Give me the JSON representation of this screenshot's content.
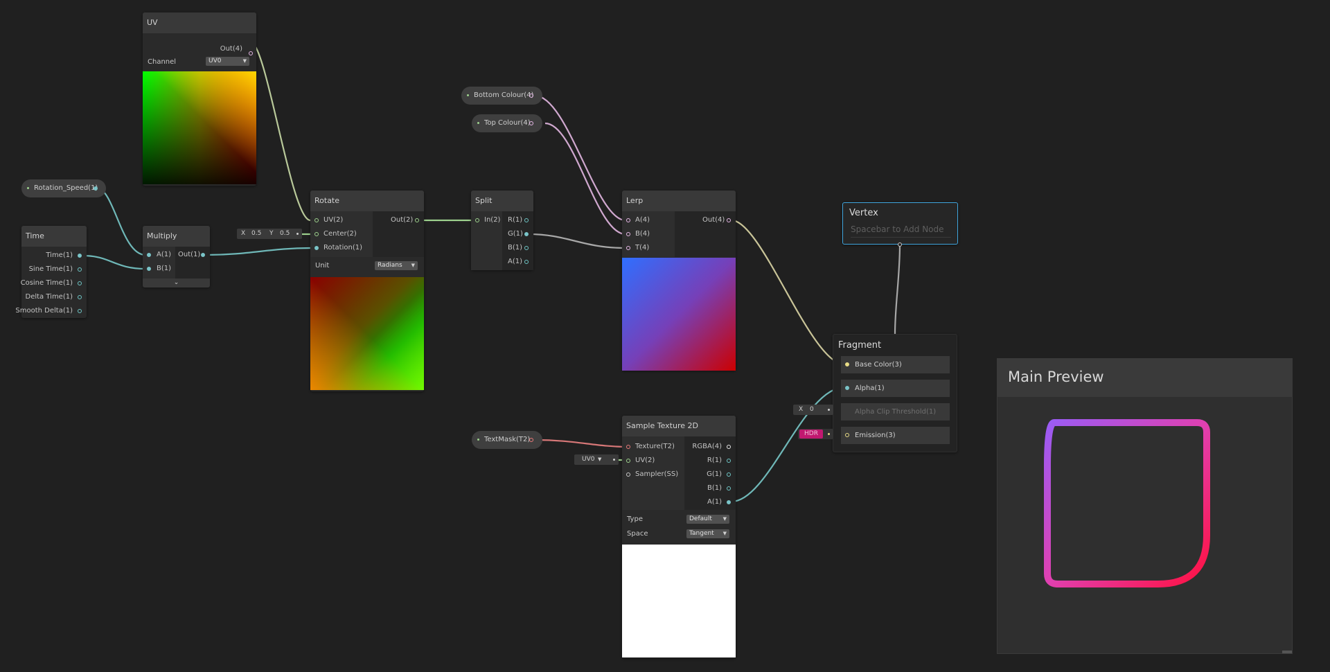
{
  "nodes": {
    "uv": {
      "title": "UV",
      "out": "Out(4)",
      "channel_label": "Channel",
      "channel_value": "UV0"
    },
    "time": {
      "title": "Time",
      "outputs": [
        "Time(1)",
        "Sine Time(1)",
        "Cosine Time(1)",
        "Delta Time(1)",
        "Smooth Delta(1)"
      ]
    },
    "multiply": {
      "title": "Multiply",
      "in_a": "A(1)",
      "in_b": "B(1)",
      "out": "Out(1)",
      "expand_icon": "chevron-down-icon"
    },
    "rotate": {
      "title": "Rotate",
      "in_uv": "UV(2)",
      "in_center": "Center(2)",
      "in_rotation": "Rotation(1)",
      "out": "Out(2)",
      "unit_label": "Unit",
      "unit_value": "Radians",
      "center_x_label": "X",
      "center_x": "0.5",
      "center_y_label": "Y",
      "center_y": "0.5"
    },
    "split": {
      "title": "Split",
      "in": "In(2)",
      "outputs": [
        "R(1)",
        "G(1)",
        "B(1)",
        "A(1)"
      ]
    },
    "lerp": {
      "title": "Lerp",
      "in_a": "A(4)",
      "in_b": "B(4)",
      "in_t": "T(4)",
      "out": "Out(4)"
    },
    "sample_texture": {
      "title": "Sample Texture 2D",
      "in_texture": "Texture(T2)",
      "in_uv": "UV(2)",
      "in_sampler": "Sampler(SS)",
      "outputs": [
        "RGBA(4)",
        "R(1)",
        "G(1)",
        "B(1)",
        "A(1)"
      ],
      "type_label": "Type",
      "type_value": "Default",
      "space_label": "Space",
      "space_value": "Tangent",
      "uv_default": "UV0"
    }
  },
  "properties": {
    "rotation_speed": "Rotation_Speed(1)",
    "bottom_colour": "Bottom Colour(4)",
    "top_colour": "Top Colour(4)",
    "text_mask": "TextMask(T2)"
  },
  "master": {
    "vertex_title": "Vertex",
    "vertex_placeholder": "Spacebar to Add Node",
    "fragment_title": "Fragment",
    "slots": [
      "Base Color(3)",
      "Alpha(1)",
      "Alpha Clip Threshold(1)",
      "Emission(3)"
    ],
    "alpha_clip_x_label": "X",
    "alpha_clip_x": "0",
    "emission_badge": "HDR"
  },
  "main_preview": {
    "title": "Main Preview"
  },
  "colors": {
    "background": "#202020",
    "vector1_port": "#7ac4c8",
    "vector4_port": "#e6b8e6",
    "vector2_port": "#9ed28e",
    "vector3_port": "#e8dc86",
    "texture_port": "#e87a7a",
    "selection": "#3fa5dd",
    "hdr_badge": "#c11870"
  }
}
